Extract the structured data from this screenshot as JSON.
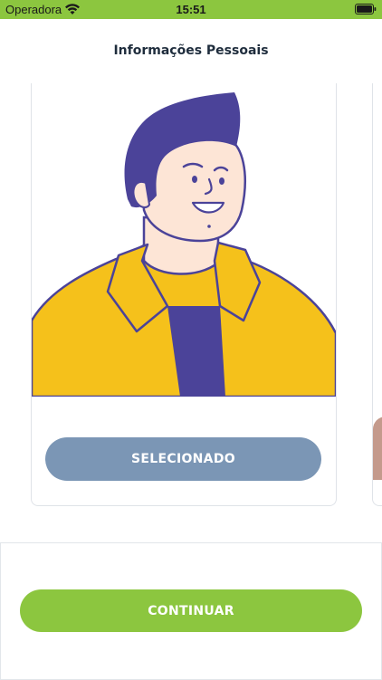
{
  "status_bar": {
    "carrier": "Operadora",
    "time": "15:51",
    "wifi_icon": "wifi-icon",
    "battery_icon": "battery-icon"
  },
  "header": {
    "title": "Informações Pessoais"
  },
  "avatar_carousel": {
    "selected_card": {
      "illustration": "man-avatar-illustration",
      "button_label": "SELECIONADO"
    }
  },
  "footer": {
    "continue_label": "CONTINUAR"
  },
  "colors": {
    "status_bar": "#8cc63f",
    "continue_button": "#8cc63f",
    "selected_button": "#7b96b5",
    "hair_shirt": "#4b4399",
    "jacket": "#f5c11b",
    "skin": "#fde5d6"
  }
}
